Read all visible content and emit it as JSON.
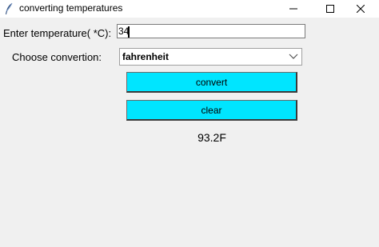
{
  "window": {
    "title": "converting temperatures",
    "app_icon": "feather-icon",
    "minimize_icon": "minimize-icon",
    "maximize_icon": "maximize-icon",
    "close_icon": "close-icon"
  },
  "form": {
    "temperature_label": "Enter temperature( *C):",
    "temperature_value": "34",
    "conversion_label": "Choose convertion:",
    "conversion_selected": "fahrenheit",
    "convert_label": "convert",
    "clear_label": "clear",
    "result": "93.2F"
  },
  "colors": {
    "button_bg": "#00e5ff",
    "window_bg": "#f0f0f0"
  }
}
